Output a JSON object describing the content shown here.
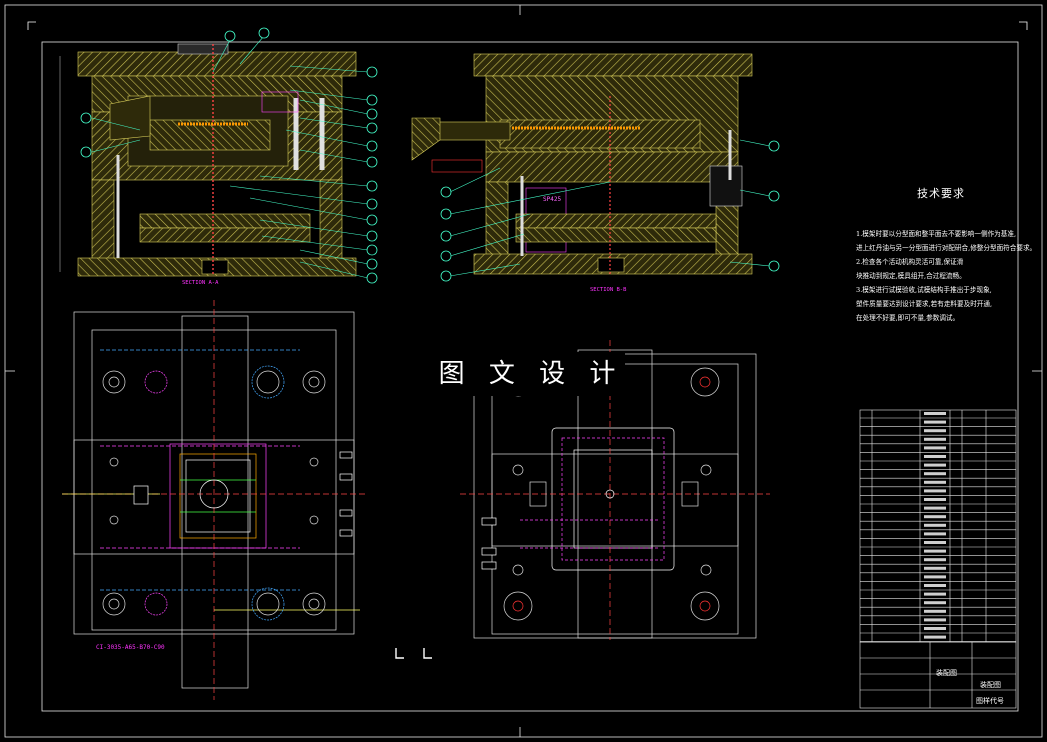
{
  "drawing": {
    "section_a": "SECTION A-A",
    "section_b": "SECTION B-B",
    "tech_title": "技术要求",
    "tech_notes": [
      {
        "num": "1",
        "text": ".模架时要以分型面和整平面去不要影响一侧作为基准,"
      },
      {
        "num": "",
        "text": "进上红丹油与另一分型面进行对配研合,修整分型面符合要求。"
      },
      {
        "num": "2",
        "text": ".检查各个活动机构灵活可靠,保证滑"
      },
      {
        "num": "",
        "text": "块推动到规定,模具组开,合过程流畅。"
      },
      {
        "num": "3",
        "text": ".模架进行试模验收,试模结构手推出于步现象,"
      },
      {
        "num": "",
        "text": "塑件质量要达到设计要求,若有走料要及时开通,"
      },
      {
        "num": "",
        "text": "在处理不好要,即可不量,参数调试。"
      }
    ],
    "watermark": "图 文 设 计",
    "plate_code": "CI-3035-A65-B70-C90",
    "cavity_label": "SP425",
    "title_block": {
      "name": "装配图",
      "doc": "装配图",
      "code": "图样代号"
    }
  }
}
